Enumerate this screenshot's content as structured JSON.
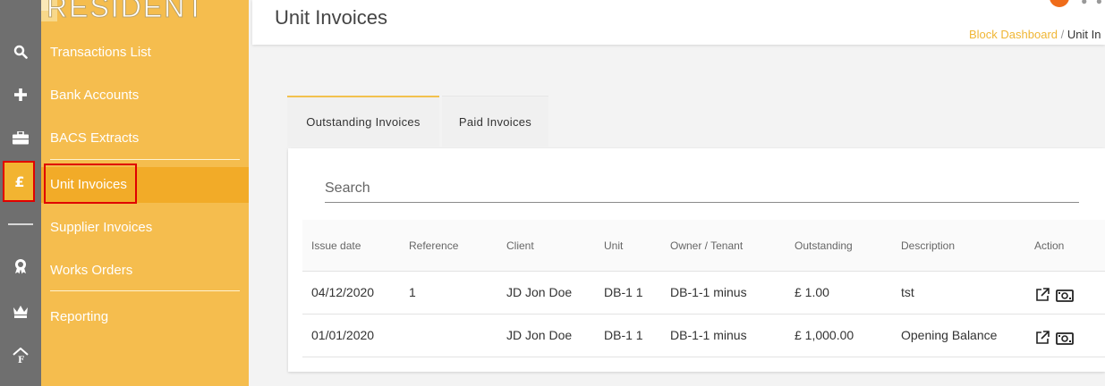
{
  "brand": {
    "logo_text": "RESIDENT"
  },
  "rail": {
    "icons": [
      "search-icon",
      "plus-icon",
      "briefcase-icon",
      "pound-icon",
      "badge-icon",
      "crown-icon",
      "house-f-icon"
    ],
    "active_symbol": "£"
  },
  "menu": {
    "items": [
      {
        "label": "Transactions List"
      },
      {
        "label": "Bank Accounts"
      },
      {
        "label": "BACS Extracts"
      },
      {
        "label": "Unit Invoices"
      },
      {
        "label": "Supplier Invoices"
      },
      {
        "label": "Works Orders"
      },
      {
        "label": "Reporting"
      }
    ],
    "active": "Unit Invoices"
  },
  "header": {
    "title": "Unit Invoices",
    "breadcrumb": {
      "link": "Block Dashboard",
      "separator": "/",
      "current": "Unit In"
    }
  },
  "tabs": [
    {
      "label": "Outstanding Invoices",
      "active": true
    },
    {
      "label": "Paid Invoices",
      "active": false
    }
  ],
  "search": {
    "placeholder": "Search",
    "value": ""
  },
  "table": {
    "headers": [
      "Issue date",
      "Reference",
      "Client",
      "Unit",
      "Owner / Tenant",
      "Outstanding",
      "Description",
      "Action"
    ],
    "rows": [
      {
        "issue_date": "04/12/2020",
        "reference": "1",
        "client": "JD Jon Doe",
        "unit": "DB-1 1",
        "owner_tenant": "DB-1-1 minus",
        "outstanding": "£ 1.00",
        "description": "tst"
      },
      {
        "issue_date": "01/01/2020",
        "reference": "",
        "client": "JD Jon Doe",
        "unit": "DB-1 1",
        "owner_tenant": "DB-1-1 minus",
        "outstanding": "£ 1,000.00",
        "description": "Opening Balance"
      }
    ]
  },
  "colors": {
    "accent": "#f5bd4e",
    "accent_active": "#f2ab28",
    "rail": "#6f6f6f",
    "highlight_border": "#e00000",
    "breadcrumb_link": "#f0b634"
  }
}
